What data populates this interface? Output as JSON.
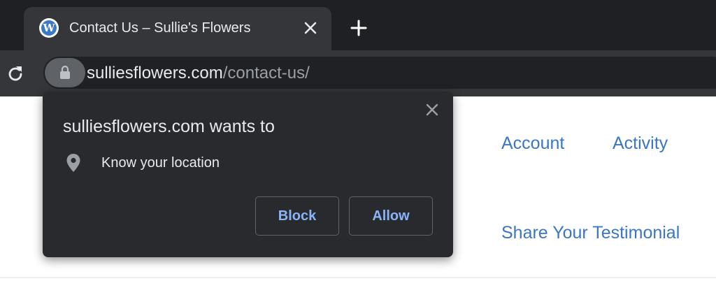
{
  "browser": {
    "tab": {
      "favicon": "wordpress-icon",
      "title": "Contact Us – Sullie's Flowers"
    },
    "address_bar": {
      "host": "sulliesflowers.com",
      "path": "/contact-us/"
    }
  },
  "page": {
    "nav": {
      "account": "Account",
      "activity": "Activity",
      "testimonial": "Share Your Testimonial"
    }
  },
  "permission_popup": {
    "title": "sulliesflowers.com wants to",
    "permission": "Know your location",
    "permission_icon": "location-pin-icon",
    "block_label": "Block",
    "allow_label": "Allow"
  },
  "colors": {
    "tabstrip_bg": "#1f2023",
    "toolbar_bg": "#35363a",
    "popup_bg": "#292a2d",
    "button_text": "#8ab4f8",
    "link": "#3a76c4"
  }
}
